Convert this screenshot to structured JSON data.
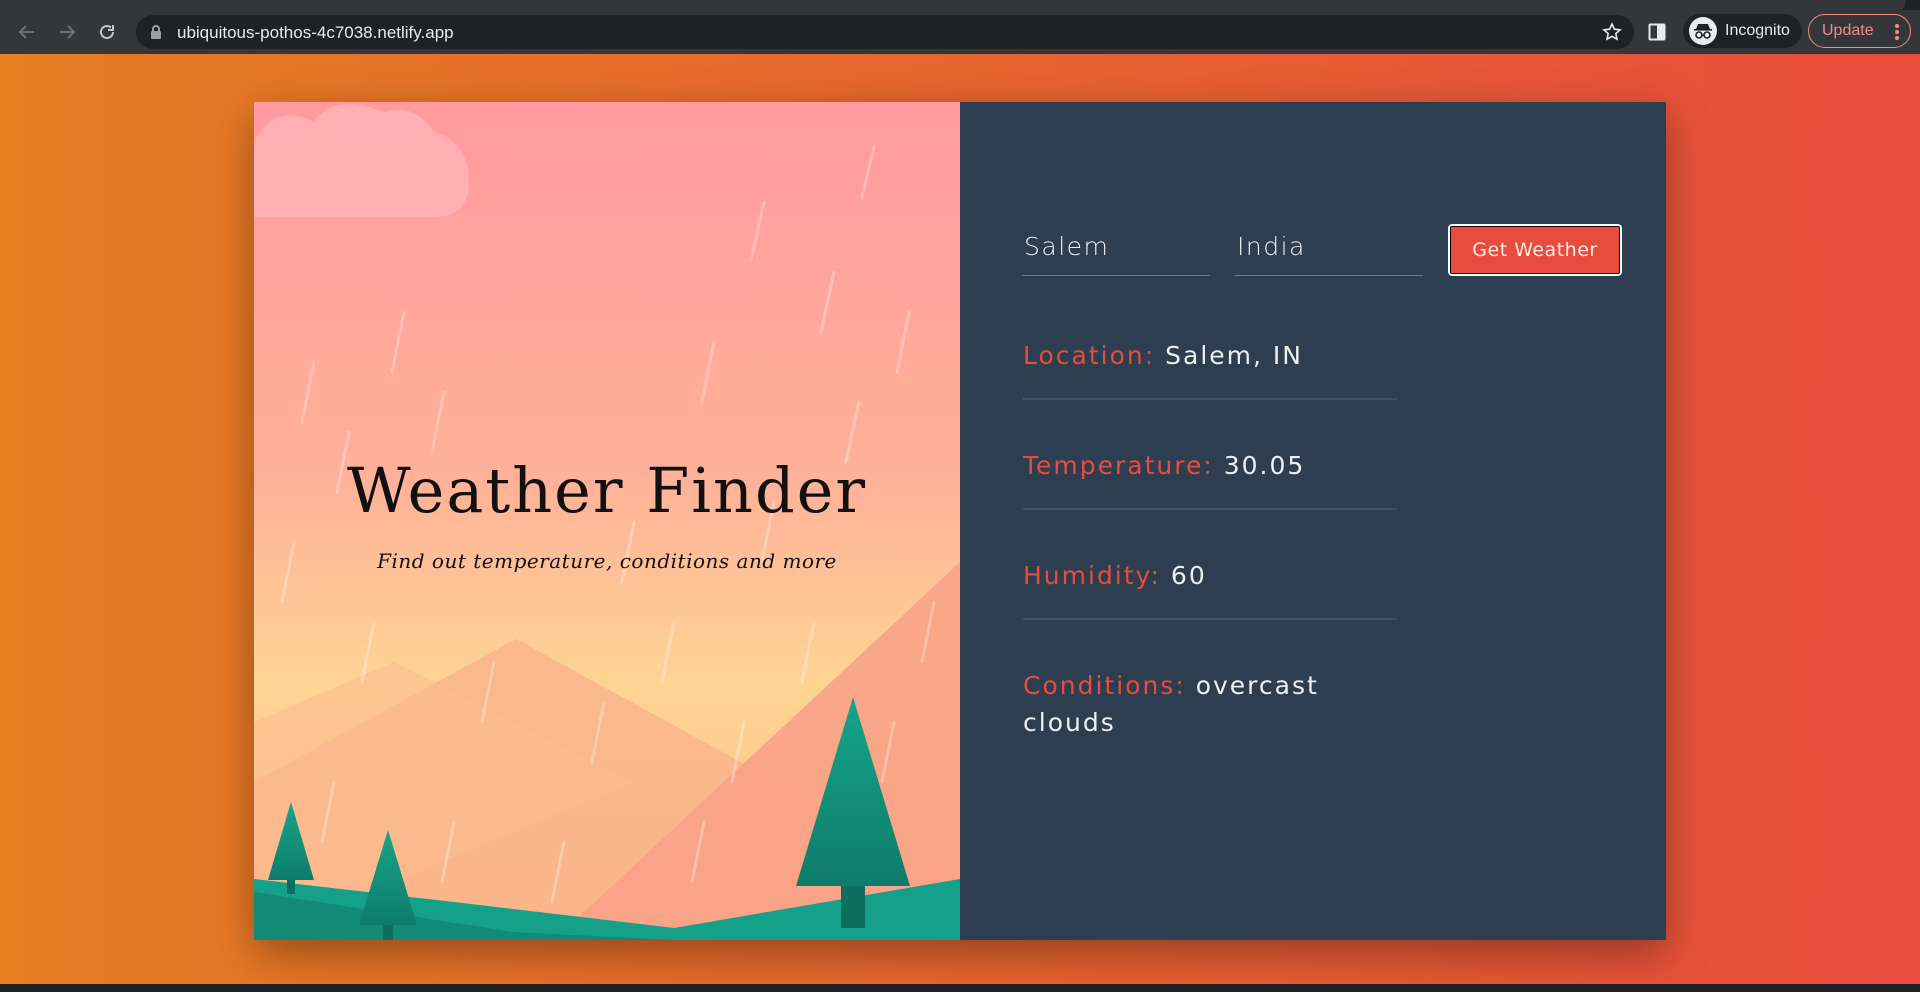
{
  "browser": {
    "url": "ubiquitous-pothos-4c7038.netlify.app",
    "profile_label": "Incognito",
    "update_label": "Update"
  },
  "page": {
    "title": "Weather Finder",
    "subtitle": "Find out temperature, conditions and more",
    "form": {
      "city_value": "Salem",
      "country_value": "India",
      "submit_label": "Get Weather"
    },
    "results": {
      "location": {
        "label": "Location:",
        "value": "Salem, IN"
      },
      "temperature": {
        "label": "Temperature:",
        "value": "30.05"
      },
      "humidity": {
        "label": "Humidity:",
        "value": "60"
      },
      "conditions": {
        "label": "Conditions:",
        "value": "overcast clouds"
      }
    }
  },
  "colors": {
    "background_gradient": [
      "#e67e22",
      "#e74c3c"
    ],
    "panel": "#2c3e50",
    "accent": "#e74c3c",
    "text": "#ecf0f1"
  },
  "icons": [
    "back-arrow-icon",
    "forward-arrow-icon",
    "reload-icon",
    "lock-icon",
    "star-icon",
    "side-panel-icon",
    "incognito-icon",
    "more-vert-icon"
  ]
}
